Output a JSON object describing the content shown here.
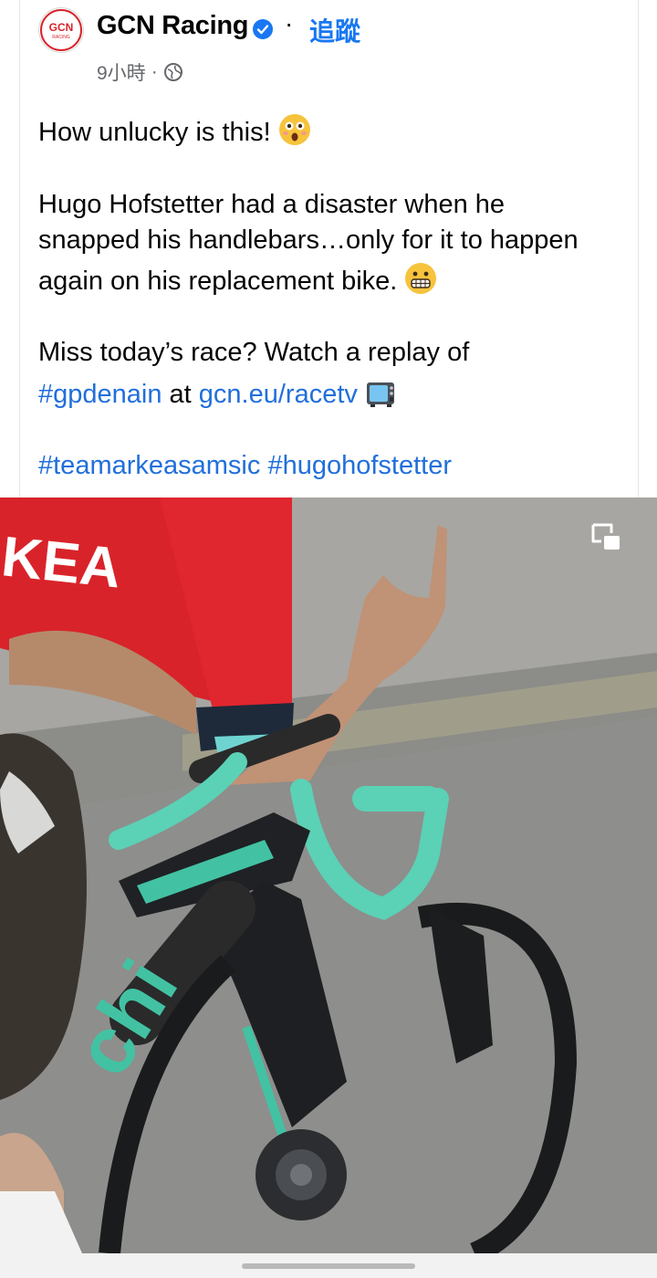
{
  "post": {
    "author": "GCN Racing",
    "separator": "·",
    "follow_label": "追蹤",
    "time": "9小時",
    "meta_separator": "·",
    "logo_text": "GCN",
    "logo_subtext": "RACING"
  },
  "content": {
    "line1": "How unlucky is this!",
    "line2": "Hugo Hofstetter had a disaster when he",
    "line3": "snapped his handlebars…only for it to happen",
    "line4": "again on his replacement bike.",
    "line5": "Miss today’s race? Watch a replay of",
    "hashtag_race": "#gpdenain",
    "at_word": "at",
    "racetv_link": "gcn.eu/racetv",
    "hashtag_team": "#teamarkeasamsic",
    "hashtag_rider": "#hugohofstetter"
  },
  "video": {
    "jersey_text": "KEA",
    "frame_text": "chi",
    "pip_icon": "picture-in-picture-icon"
  },
  "colors": {
    "link": "#216fdb",
    "follow": "#1877f2",
    "jersey_red": "#d9232a",
    "bar_tape": "#5bd1b5"
  }
}
